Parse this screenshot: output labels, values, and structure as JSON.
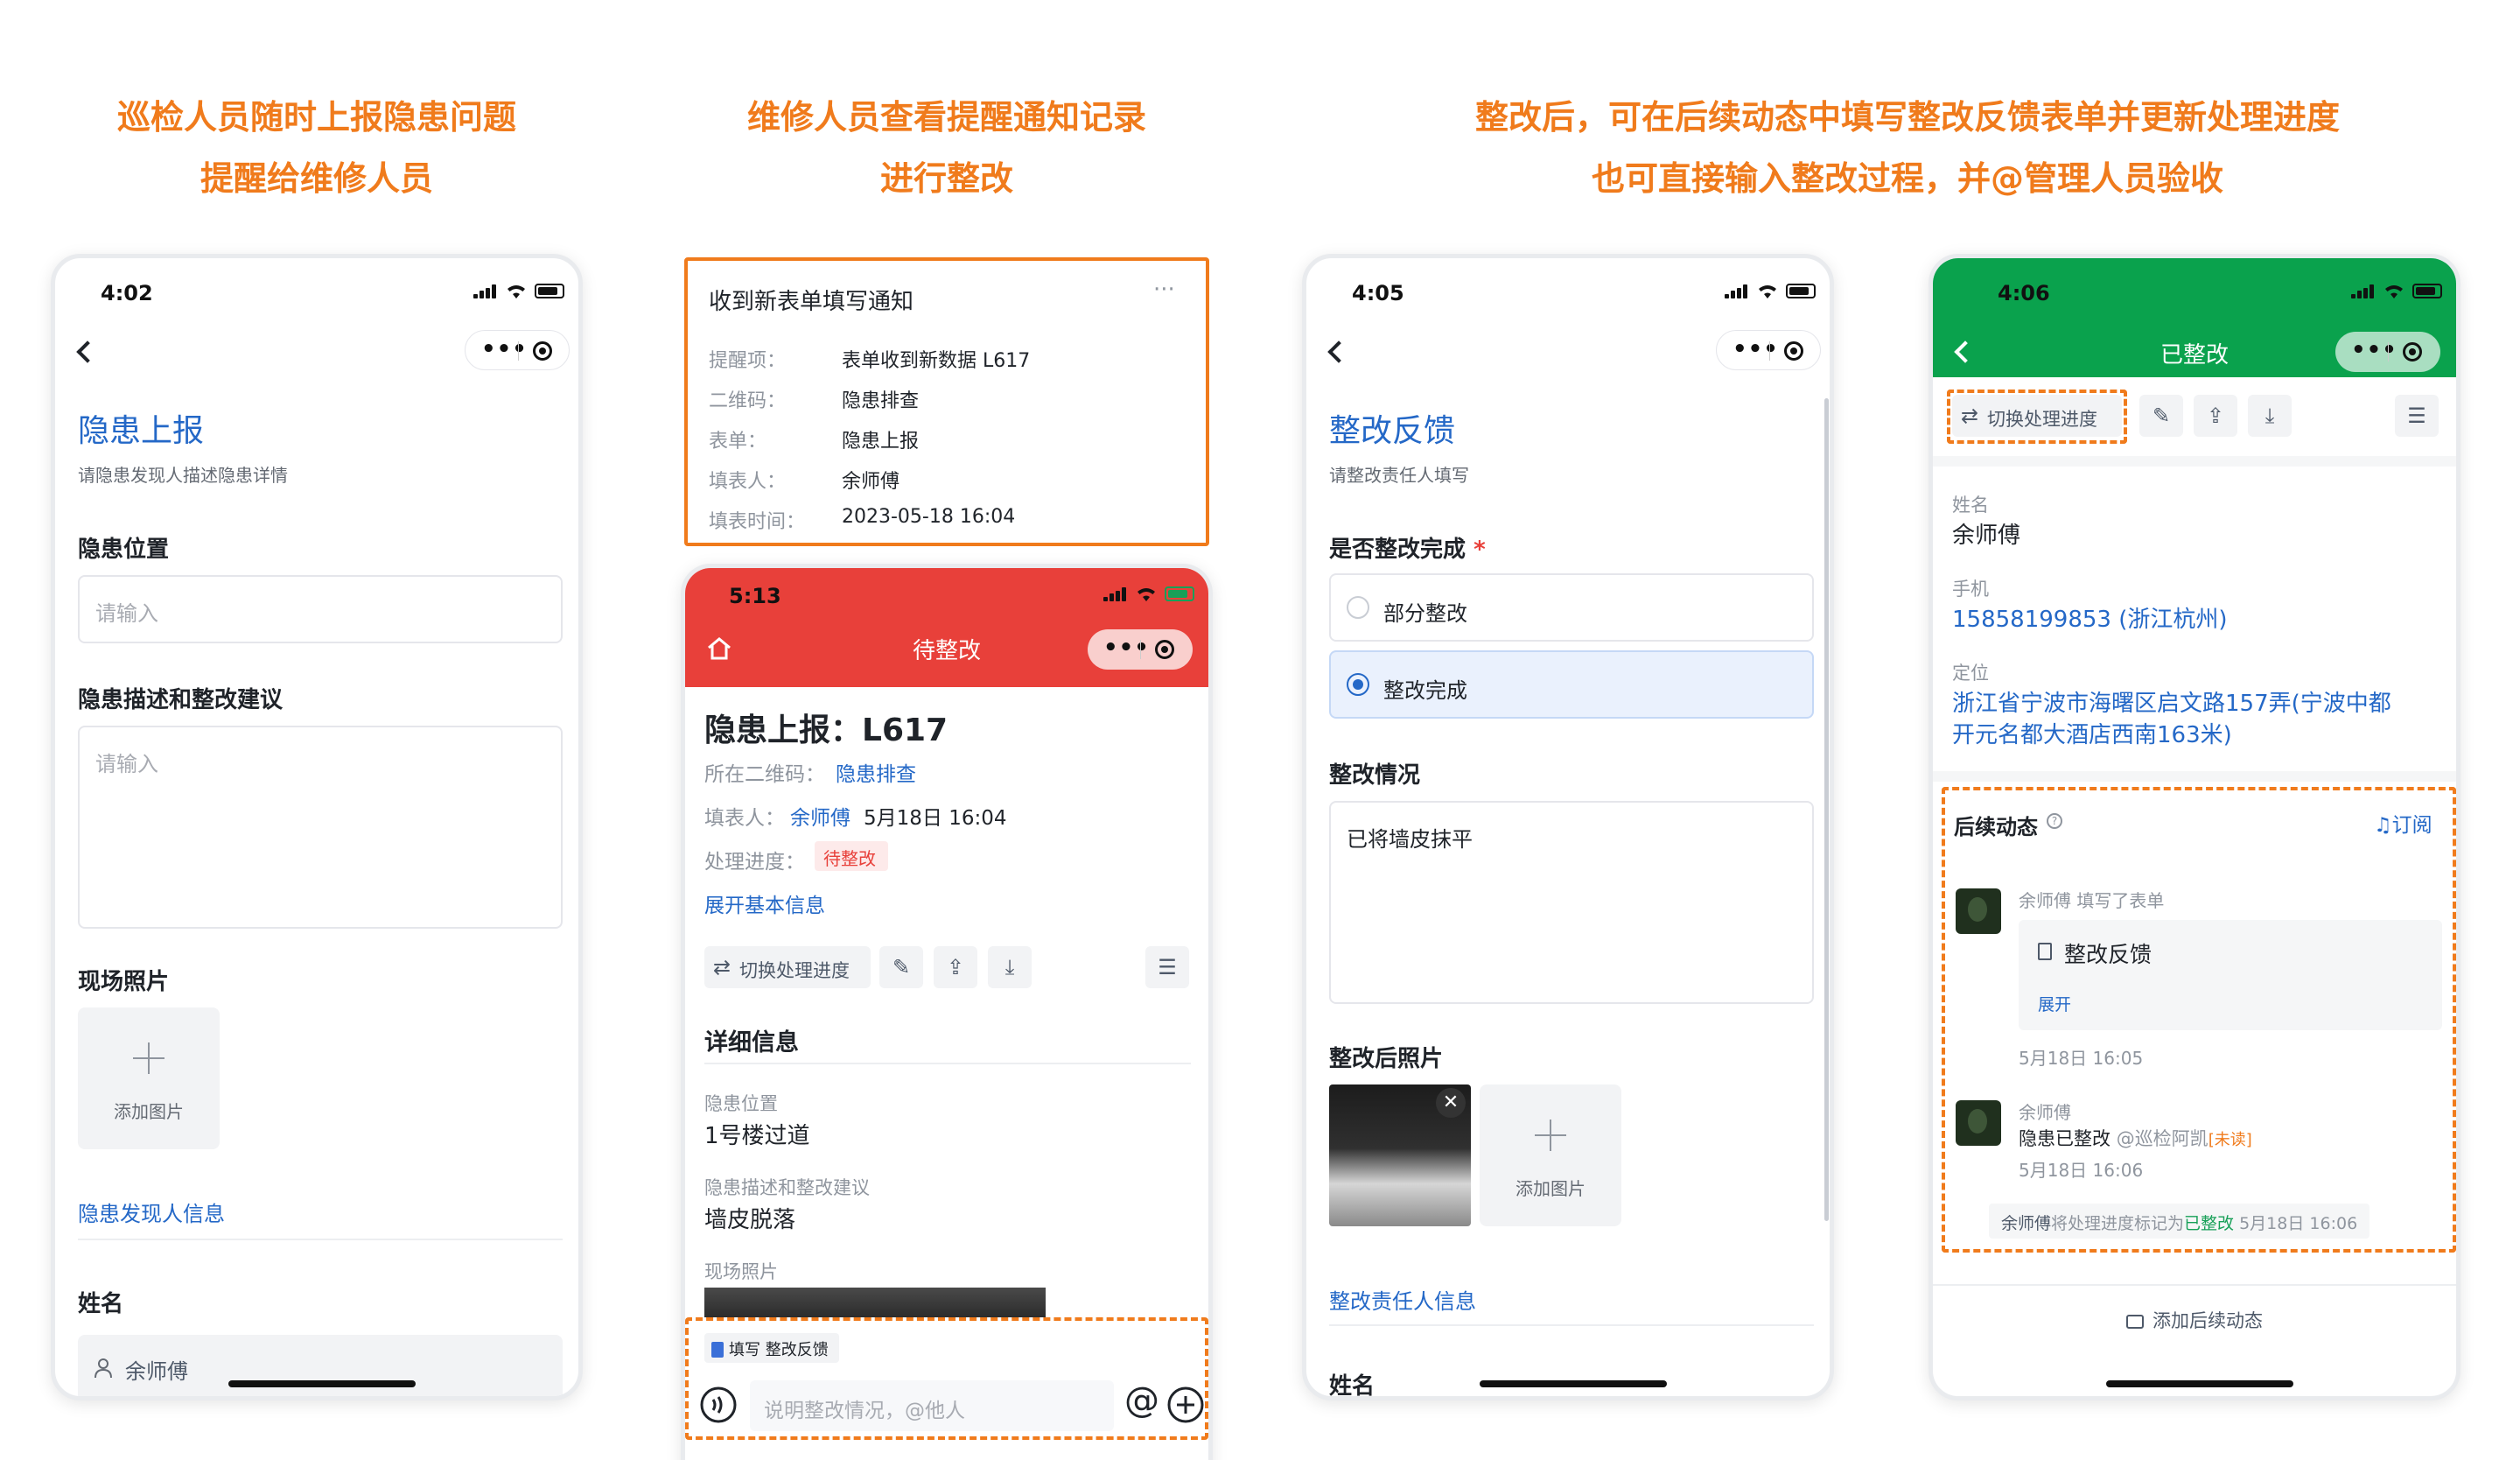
{
  "captions": {
    "col1": [
      "巡检人员随时上报隐患问题",
      "提醒给维修人员"
    ],
    "col2": [
      "维修人员查看提醒通知记录",
      "进行整改"
    ],
    "col3": [
      "整改后，可在后续动态中填写整改反馈表单并更新处理进度",
      "也可直接输入整改过程，并@管理人员验收"
    ]
  },
  "colors": {
    "caption": "#f07b1c",
    "link": "#2468c7",
    "red_header": "#e8403a",
    "green_header": "#0aa24d",
    "status_done": "#18a058"
  },
  "phone1": {
    "time": "4:02",
    "title": "隐患上报",
    "subtitle": "请隐患发现人描述隐患详情",
    "field1_label": "隐患位置",
    "field1_placeholder": "请输入",
    "field2_label": "隐患描述和整改建议",
    "field2_placeholder": "请输入",
    "photo_label": "现场照片",
    "add_photo": "添加图片",
    "section_link": "隐患发现人信息",
    "name_label": "姓名",
    "name_value": "余师傅",
    "icons": {
      "back": "chevron-left-icon",
      "more": "more-dots-icon",
      "close": "target-icon",
      "plus": "plus-icon",
      "user": "user-icon"
    }
  },
  "notification": {
    "title": "收到新表单填写通知",
    "more": "···",
    "rows": [
      {
        "k": "提醒项：",
        "v": "表单收到新数据 L617"
      },
      {
        "k": "二维码：",
        "v": "隐患排查"
      },
      {
        "k": "表单：",
        "v": "隐患上报"
      },
      {
        "k": "填表人：",
        "v": "余师傅"
      },
      {
        "k": "填表时间：",
        "v": "2023-05-18 16:04"
      }
    ]
  },
  "phone2": {
    "time": "5:13",
    "header_title": "待整改",
    "record_title": "隐患上报：L617",
    "qr_label": "所在二维码：",
    "qr_value": "隐患排查",
    "filler_label": "填表人：",
    "filler_name": "余师傅",
    "filler_time": "5月18日 16:04",
    "status_label": "处理进度：",
    "status_value": "待整改",
    "expand_link": "展开基本信息",
    "switch_btn": "切换处理进度",
    "detail_title": "详细信息",
    "d1_key": "隐患位置",
    "d1_val": "1号楼过道",
    "d2_key": "隐患描述和整改建议",
    "d2_val": "墙皮脱落",
    "d3_key": "现场照片",
    "fill_tag": "填写 整改反馈",
    "input_placeholder": "说明整改情况，@他人",
    "at": "@",
    "icons": {
      "home": "home-icon",
      "swap": "swap-icon",
      "edit": "edit-icon",
      "share": "share-icon",
      "download": "download-icon",
      "menu": "menu-icon",
      "voice": "voice-icon",
      "add": "plus-circle-icon",
      "form": "form-icon"
    }
  },
  "phone3": {
    "time": "4:05",
    "title": "整改反馈",
    "subtitle": "请整改责任人填写",
    "q1_label": "是否整改完成",
    "required": "*",
    "opt1": "部分整改",
    "opt2": "整改完成",
    "q2_label": "整改情况",
    "q2_value": "已将墙皮抹平",
    "photo_label": "整改后照片",
    "add_photo": "添加图片",
    "section_link": "整改责任人信息",
    "name_label": "姓名"
  },
  "phone4": {
    "time": "4:06",
    "header_title": "已整改",
    "switch_btn": "切换处理进度",
    "name_key": "姓名",
    "name_val": "余师傅",
    "phone_key": "手机",
    "phone_val": "15858199853 (浙江杭州)",
    "loc_key": "定位",
    "loc_val1": "浙江省宁波市海曙区启文路157弄(宁波中都",
    "loc_val2": "开元名都大酒店西南163米)",
    "follow_title": "后续动态",
    "subscribe": "订阅",
    "a1_user": "余师傅",
    "a1_action": "填写了表单",
    "a1_card_title": "整改反馈",
    "a1_expand": "展开",
    "a1_time": "5月18日 16:05",
    "a2_user": "余师傅",
    "a2_text": "隐患已整改",
    "a2_mention": "@巡检阿凯",
    "a2_unread": "[未读]",
    "a2_time": "5月18日 16:06",
    "status_user": "余师傅",
    "status_mid": "将处理进度标记为",
    "status_val": "已整改",
    "status_time": "5月18日 16:06",
    "add_follow": "添加后续动态",
    "icons": {
      "help": "help-circle-icon",
      "bell": "bell-icon",
      "comment": "comment-icon"
    }
  }
}
